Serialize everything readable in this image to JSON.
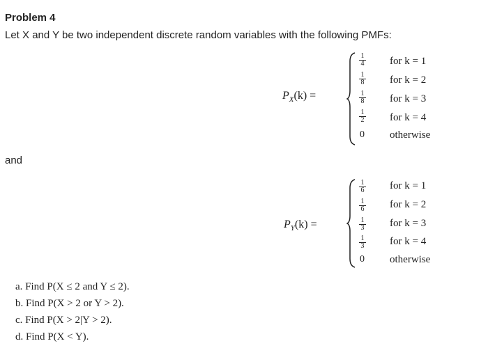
{
  "problem": {
    "title": "Problem 4",
    "intro": "Let X and Y be two independent discrete random variables with the following PMFs:",
    "connector": "and"
  },
  "pmf_x": {
    "lhs": "P",
    "sub": "X",
    "arg": "(k) =",
    "rows": [
      {
        "num": "1",
        "den": "4",
        "cond": "for k = 1"
      },
      {
        "num": "1",
        "den": "8",
        "cond": "for k = 2"
      },
      {
        "num": "1",
        "den": "8",
        "cond": "for k = 3"
      },
      {
        "num": "1",
        "den": "2",
        "cond": "for k = 4"
      }
    ],
    "zero": "0",
    "otherwise": "otherwise"
  },
  "pmf_y": {
    "lhs": "P",
    "sub": "Y",
    "arg": "(k) =",
    "rows": [
      {
        "num": "1",
        "den": "6",
        "cond": "for k = 1"
      },
      {
        "num": "1",
        "den": "6",
        "cond": "for k = 2"
      },
      {
        "num": "1",
        "den": "3",
        "cond": "for k = 3"
      },
      {
        "num": "1",
        "den": "3",
        "cond": "for k = 4"
      }
    ],
    "zero": "0",
    "otherwise": "otherwise"
  },
  "questions": [
    "a. Find P(X ≤ 2 and Y ≤ 2).",
    "b. Find P(X > 2 or Y > 2).",
    "c. Find P(X > 2|Y > 2).",
    "d. Find P(X < Y)."
  ]
}
